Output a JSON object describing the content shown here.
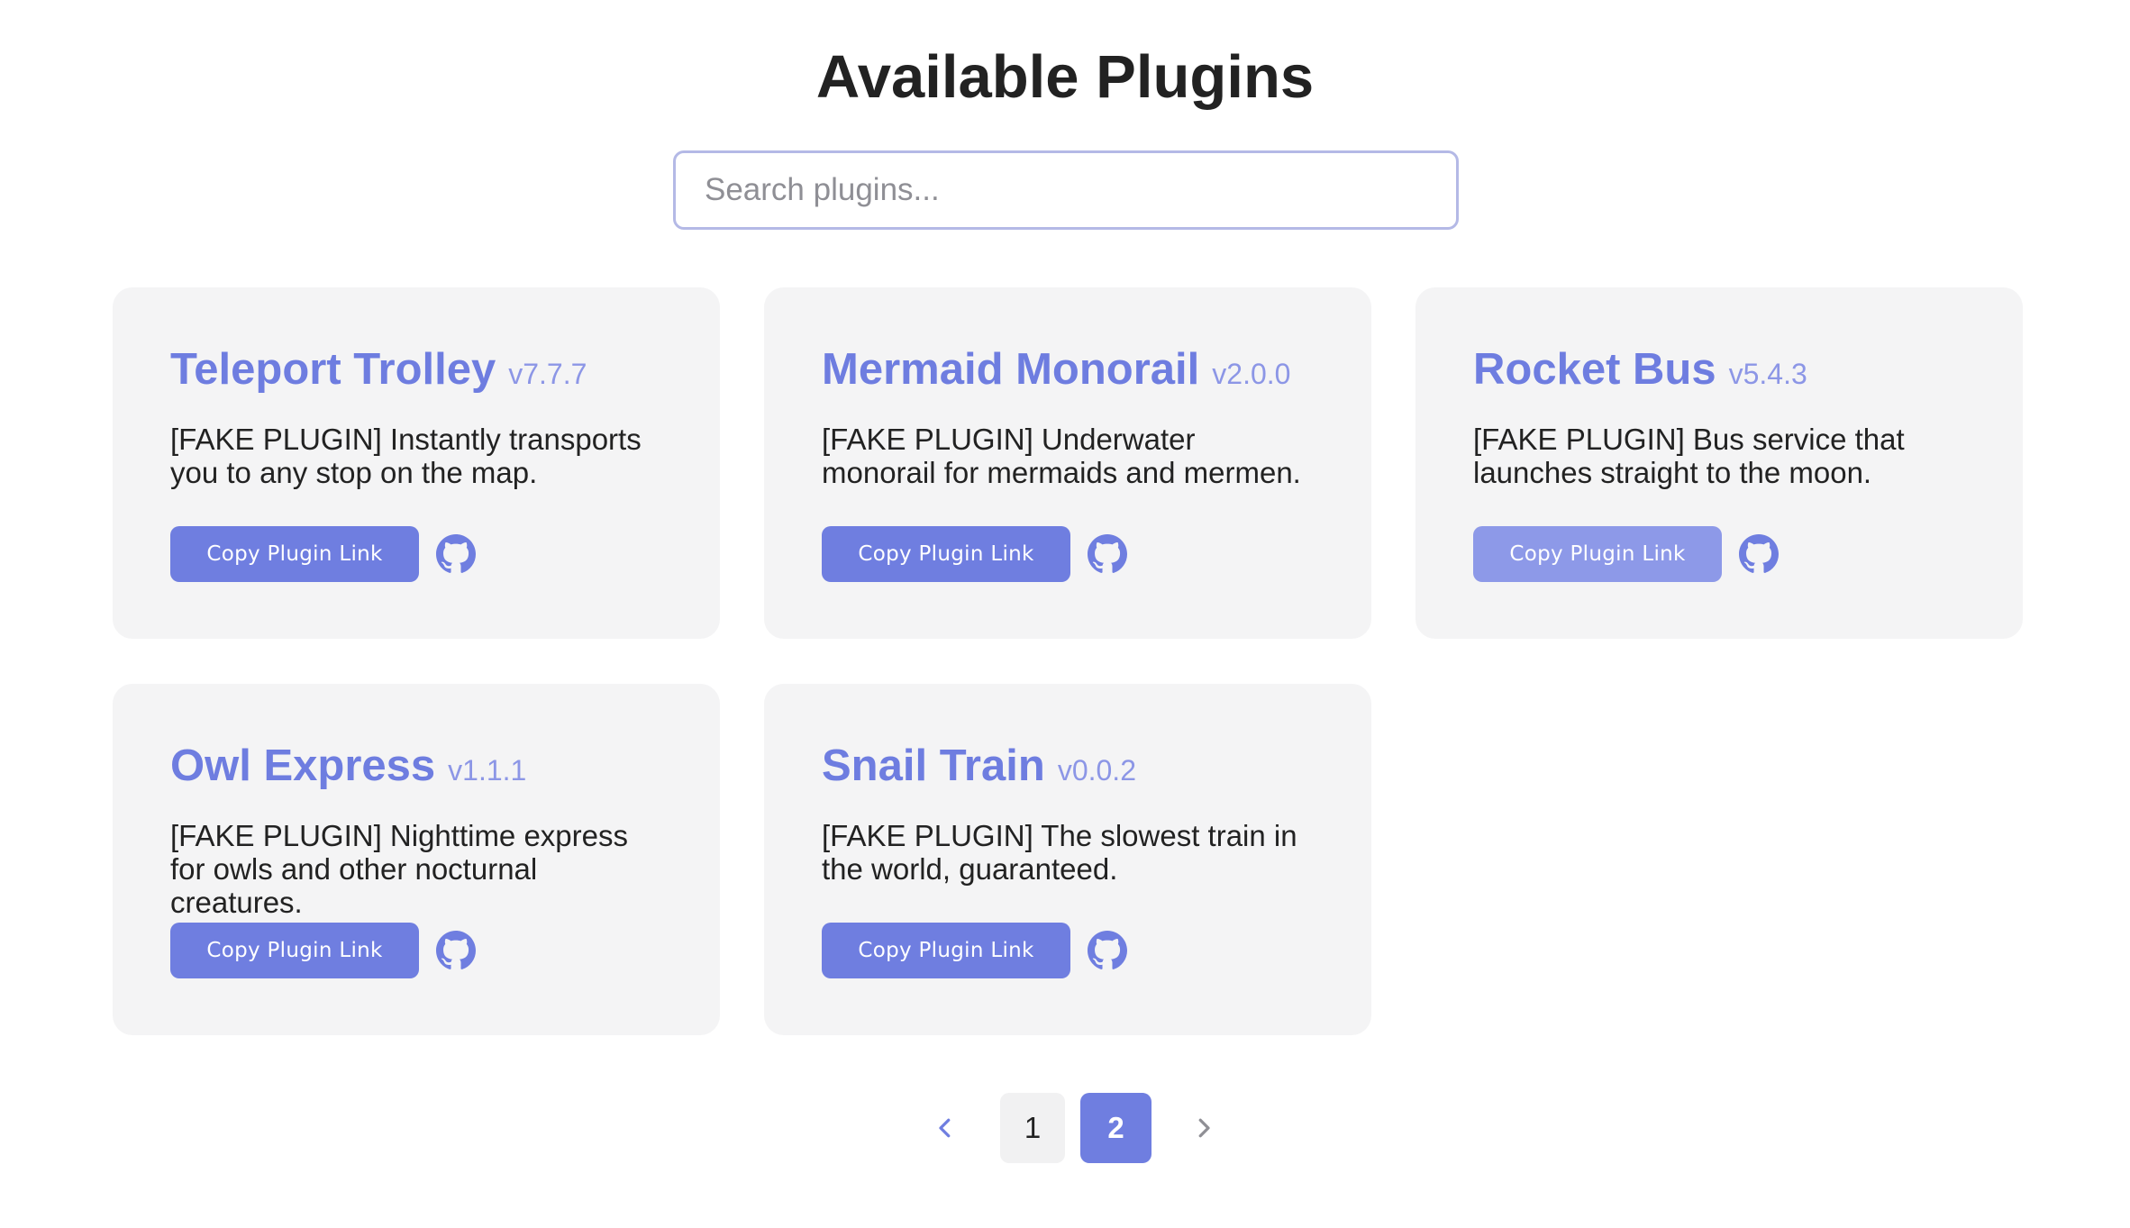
{
  "header": {
    "title": "Available Plugins"
  },
  "search": {
    "placeholder": "Search plugins...",
    "value": ""
  },
  "plugins": [
    {
      "name": "Teleport Trolley",
      "version": "v7.7.7",
      "description": "[FAKE PLUGIN] Instantly transports you to any stop on the map.",
      "button_label": "Copy Plugin Link",
      "icon": "github-icon"
    },
    {
      "name": "Mermaid Monorail",
      "version": "v2.0.0",
      "description": "[FAKE PLUGIN] Underwater monorail for mermaids and mermen.",
      "button_label": "Copy Plugin Link",
      "icon": "github-icon"
    },
    {
      "name": "Rocket Bus",
      "version": "v5.4.3",
      "description": "[FAKE PLUGIN] Bus service that launches straight to the moon.",
      "button_label": "Copy Plugin Link",
      "icon": "github-icon"
    },
    {
      "name": "Owl Express",
      "version": "v1.1.1",
      "description": "[FAKE PLUGIN] Nighttime express for owls and other nocturnal creatures.",
      "button_label": "Copy Plugin Link",
      "icon": "github-icon"
    },
    {
      "name": "Snail Train",
      "version": "v0.0.2",
      "description": "[FAKE PLUGIN] The slowest train in the world, guaranteed.",
      "button_label": "Copy Plugin Link",
      "icon": "github-icon"
    }
  ],
  "pagination": {
    "prev_icon": "chevron-left-icon",
    "next_icon": "chevron-right-icon",
    "pages": [
      "1",
      "2"
    ],
    "current_page": "2"
  },
  "colors": {
    "accent": "#6f7ee0",
    "accent_light": "#8d99e8",
    "card_background": "#f4f4f5",
    "title_text": "#222222",
    "version_text": "#8c96e6",
    "search_border": "#b4b9e6"
  }
}
